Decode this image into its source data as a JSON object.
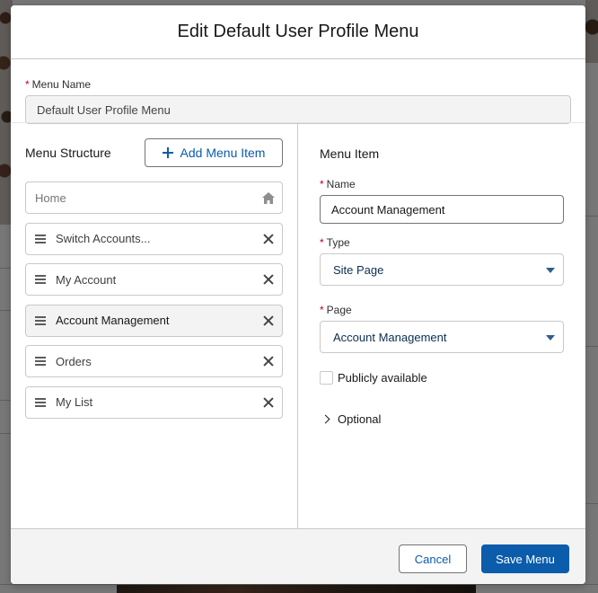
{
  "modal": {
    "title": "Edit Default User Profile Menu"
  },
  "menu_name": {
    "label": "Menu Name",
    "required_mark": "*",
    "value": "Default User Profile Menu"
  },
  "menu_structure": {
    "title": "Menu Structure",
    "add_button_label": "Add Menu Item",
    "items": [
      {
        "label": "Home",
        "type": "home",
        "icon": "home-icon"
      },
      {
        "label": "Switch Accounts...",
        "type": "item",
        "icon": "drag-handle-icon"
      },
      {
        "label": "My Account",
        "type": "item",
        "icon": "drag-handle-icon"
      },
      {
        "label": "Account Management",
        "type": "item",
        "icon": "drag-handle-icon",
        "selected": true
      },
      {
        "label": "Orders",
        "type": "item",
        "icon": "drag-handle-icon"
      },
      {
        "label": "My List",
        "type": "item",
        "icon": "drag-handle-icon"
      }
    ]
  },
  "menu_item": {
    "title": "Menu Item",
    "name": {
      "label": "Name",
      "required_mark": "*",
      "value": "Account Management"
    },
    "type": {
      "label": "Type",
      "required_mark": "*",
      "value": "Site Page"
    },
    "page": {
      "label": "Page",
      "required_mark": "*",
      "value": "Account Management"
    },
    "publicly_available": {
      "label": "Publicly available",
      "checked": false
    },
    "optional_label": "Optional"
  },
  "footer": {
    "cancel_label": "Cancel",
    "save_label": "Save Menu"
  },
  "colors": {
    "brand_blue": "#0b5cab",
    "required_red": "#ba0517",
    "border": "#c9c9c9",
    "footer_bg": "#f3f3f3"
  }
}
